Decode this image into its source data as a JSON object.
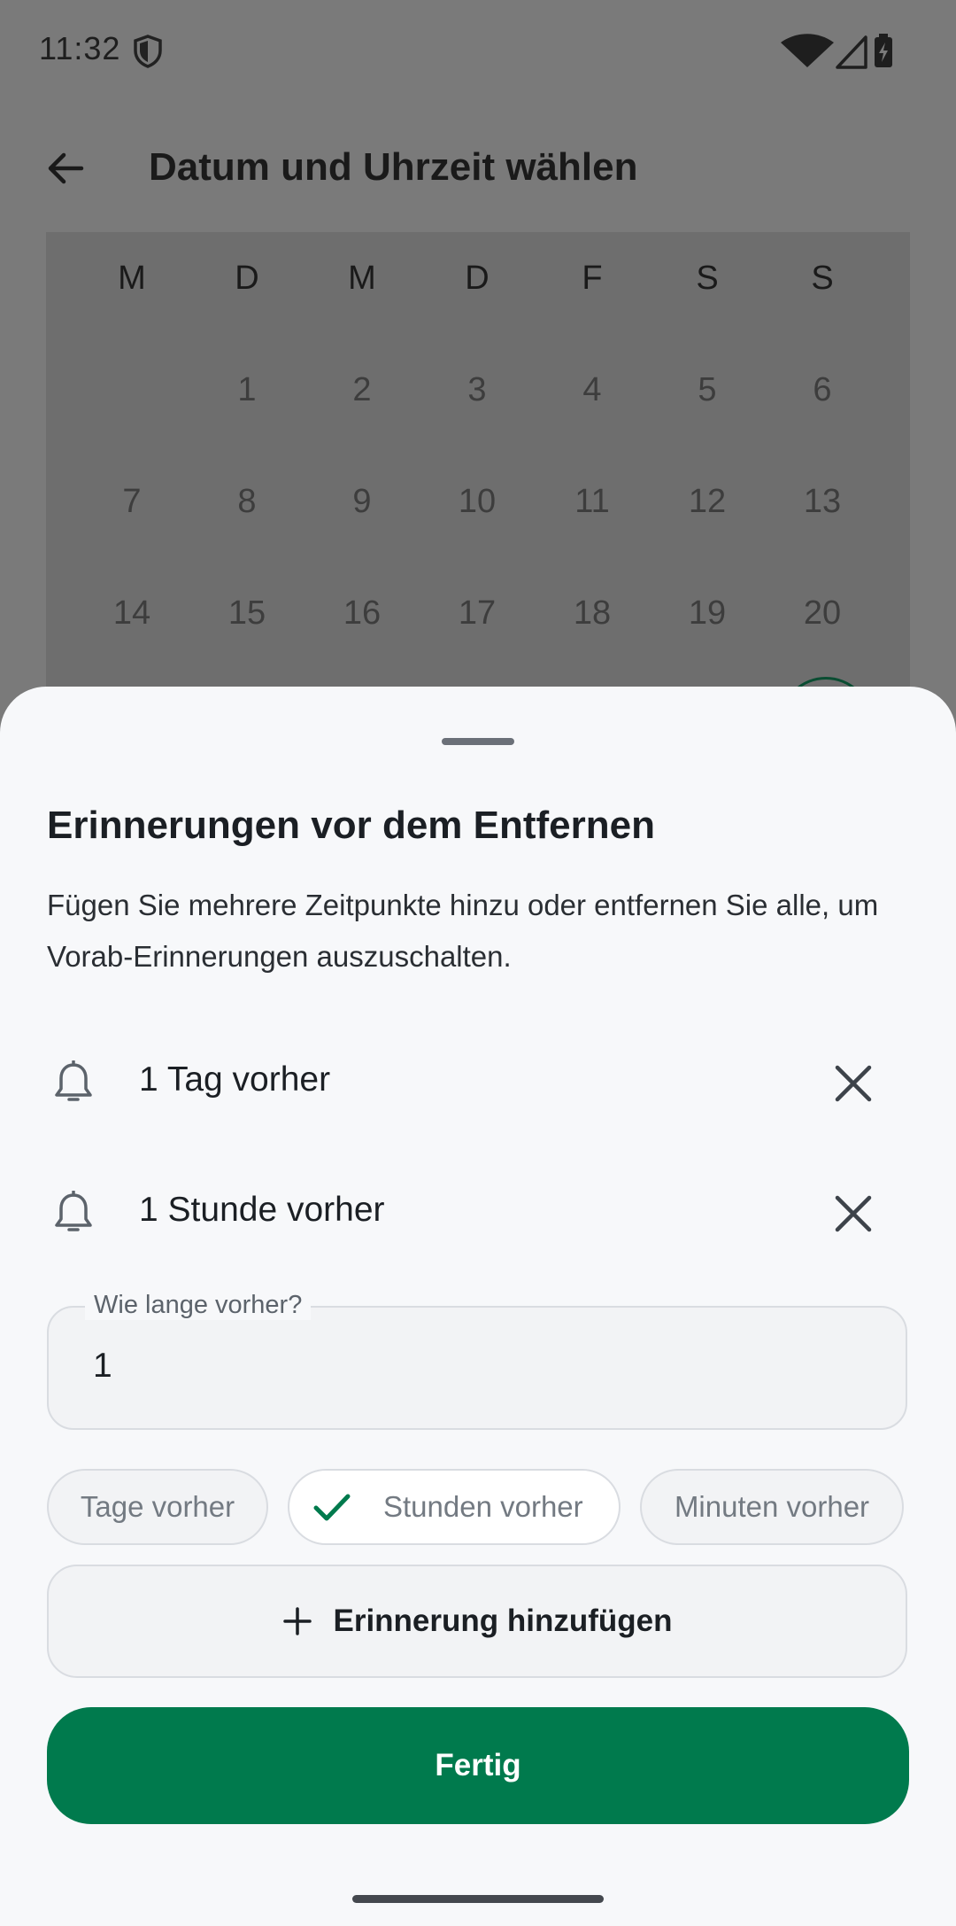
{
  "status_bar": {
    "time": "11:32",
    "icons": [
      "shield-icon",
      "wifi-icon",
      "signal-icon",
      "battery-charging-icon"
    ]
  },
  "background_screen": {
    "title": "Datum und Uhrzeit wählen",
    "weekday_headers": [
      "M",
      "D",
      "M",
      "D",
      "F",
      "S",
      "S"
    ],
    "weeks": [
      [
        "",
        "1",
        "2",
        "3",
        "4",
        "5",
        "6"
      ],
      [
        "7",
        "8",
        "9",
        "10",
        "11",
        "12",
        "13"
      ],
      [
        "14",
        "15",
        "16",
        "17",
        "18",
        "19",
        "20"
      ]
    ]
  },
  "sheet": {
    "title": "Erinnerungen vor dem Entfernen",
    "description": "Fügen Sie mehrere Zeitpunkte hinzu oder entfernen Sie alle, um Vorab-Erinnerungen auszuschalten.",
    "reminders": [
      {
        "label": "1 Tag vorher"
      },
      {
        "label": "1 Stunde vorher"
      }
    ],
    "amount_field": {
      "label": "Wie lange vorher?",
      "value": "1"
    },
    "units": [
      {
        "label": "Tage vorher",
        "selected": false
      },
      {
        "label": "Stunden vorher",
        "selected": true
      },
      {
        "label": "Minuten vorher",
        "selected": false
      }
    ],
    "add_button": "Erinnerung hinzufügen",
    "done_button": "Fertig"
  },
  "colors": {
    "primary": "#007a4d",
    "sheet_background": "#f7f8fa",
    "scrim": "#7a7a7a"
  }
}
